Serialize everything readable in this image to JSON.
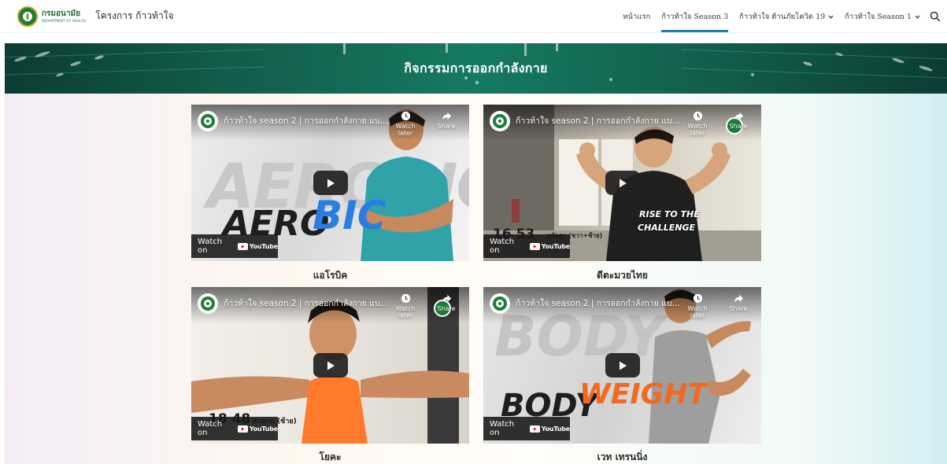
{
  "header": {
    "logo_text": "กรมอนามัย",
    "logo_subtext": "DEPARTMENT OF HEALTH",
    "site_title": "โครงการ ก้าวท้าใจ",
    "nav": [
      {
        "label": "หน้าแรก",
        "active": false,
        "has_dropdown": false
      },
      {
        "label": "ก้าวท้าใจ Season 3",
        "active": true,
        "has_dropdown": false
      },
      {
        "label": "ก้าวท้าใจ ต้านภัยโควิด 19",
        "active": false,
        "has_dropdown": true
      },
      {
        "label": "ก้าวท้าใจ Season 1",
        "active": false,
        "has_dropdown": true
      }
    ],
    "search_icon": "search-icon"
  },
  "hero": {
    "title": "กิจกรรมการออกกำลังกาย"
  },
  "colors": {
    "accent": "#1f7fa8",
    "hero_green": "#157a62",
    "youtube_red": "#ff0000"
  },
  "videos": [
    {
      "title": "ก้าวท้าใจ season 2 | การออกกำลังกาย แบ...",
      "watch_later": "Watch later",
      "share": "Share",
      "watch_on": "Watch on",
      "youtube": "YouTube",
      "caption": "แอโรบิค",
      "thumb_text": "AERO",
      "thumb_text2": "BIC",
      "bg_word": "AEROBIC"
    },
    {
      "title": "ก้าวท้าใจ season 2 | การออกกำลังกาย แบ...",
      "watch_later": "Watch later",
      "share": "Share",
      "watch_on": "Watch on",
      "youtube": "YouTube",
      "caption": "ดีตะมวยไทย",
      "overlay": "16 53",
      "overlay_sub": "หมัดฮุก (ขวา+ซ้าย)",
      "shirt_text1": "RISE TO THE",
      "shirt_text2": "CHALLENGE"
    },
    {
      "title": "ก้าวท้าใจ season 2 | การออกกำลังกาย แบ...",
      "watch_later": "Watch later",
      "share": "Share",
      "watch_on": "Watch on",
      "youtube": "YouTube",
      "caption": "โยคะ",
      "overlay": "18 48",
      "overlay_sub": "ท่าดูกบ (ซ้าย)"
    },
    {
      "title": "ก้าวท้าใจ season 2 | การออกกำลังกาย แบ...",
      "watch_later": "Watch later",
      "share": "Share",
      "watch_on": "Watch on",
      "youtube": "YouTube",
      "caption": "เวท เทรนนิ่ง",
      "thumb_text": "BODY",
      "thumb_text2": "WEIGHT",
      "bg_word": "BODY"
    }
  ]
}
